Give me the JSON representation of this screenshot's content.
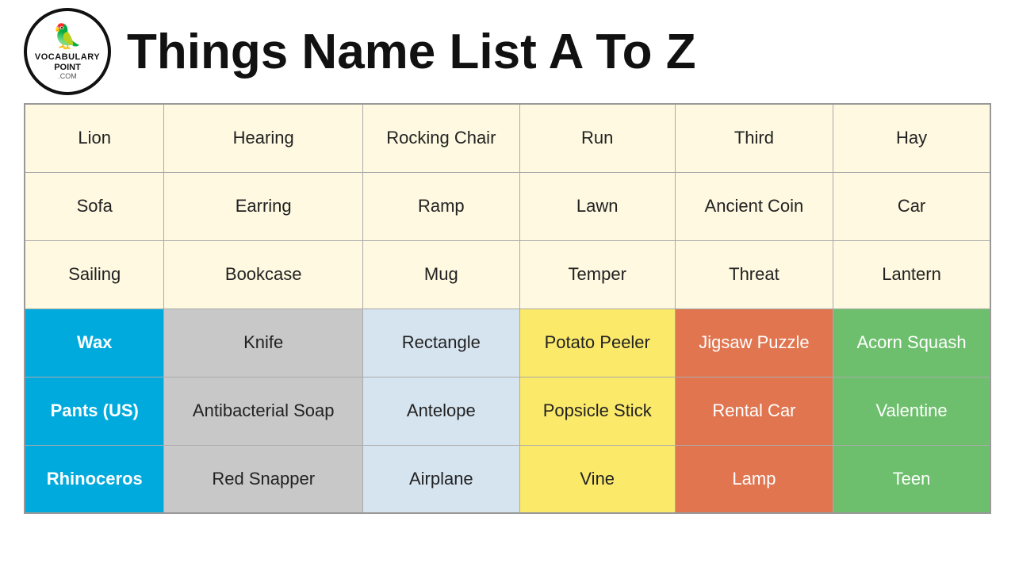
{
  "header": {
    "title": "Things Name List A To Z",
    "logo": {
      "line1": "VOCABULARY",
      "line2": "POINT",
      "line3": ".COM"
    }
  },
  "table": {
    "rows": [
      [
        "Lion",
        "Hearing",
        "Rocking Chair",
        "Run",
        "Third",
        "Hay"
      ],
      [
        "Sofa",
        "Earring",
        "Ramp",
        "Lawn",
        "Ancient Coin",
        "Car"
      ],
      [
        "Sailing",
        "Bookcase",
        "Mug",
        "Temper",
        "Threat",
        "Lantern"
      ],
      [
        "Wax",
        "Knife",
        "Rectangle",
        "Potato Peeler",
        "Jigsaw Puzzle",
        "Acorn Squash"
      ],
      [
        "Pants (US)",
        "Antibacterial Soap",
        "Antelope",
        "Popsicle Stick",
        "Rental Car",
        "Valentine"
      ],
      [
        "Rhinoceros",
        "Red Snapper",
        "Airplane",
        "Vine",
        "Lamp",
        "Teen"
      ]
    ]
  }
}
